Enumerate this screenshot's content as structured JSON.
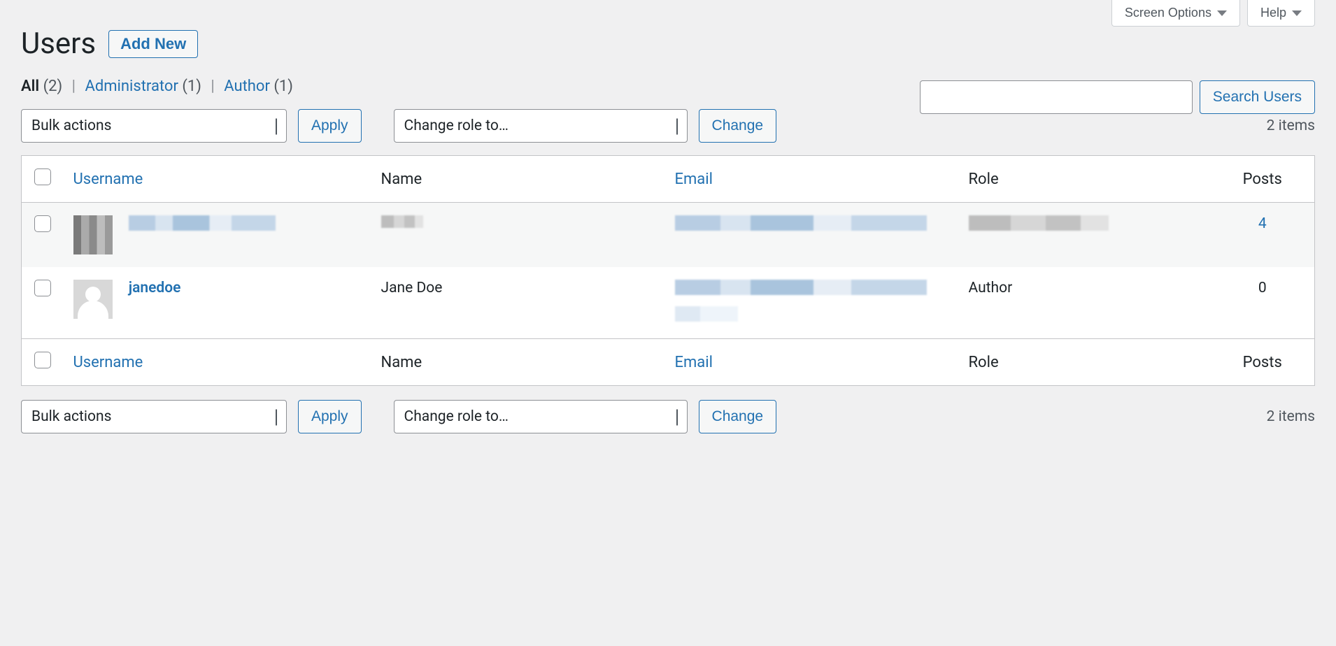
{
  "topButtons": {
    "screenOptions": "Screen Options",
    "help": "Help"
  },
  "header": {
    "title": "Users",
    "addNew": "Add New"
  },
  "filters": {
    "all_label": "All",
    "all_count": "(2)",
    "administrator_label": "Administrator",
    "administrator_count": "(1)",
    "author_label": "Author",
    "author_count": "(1)"
  },
  "search": {
    "button": "Search Users"
  },
  "bulk": {
    "bulkActions": "Bulk actions",
    "apply": "Apply",
    "changeRole": "Change role to…",
    "change": "Change"
  },
  "itemsCount": "2 items",
  "columns": {
    "username": "Username",
    "name": "Name",
    "email": "Email",
    "role": "Role",
    "posts": "Posts"
  },
  "rows": [
    {
      "username_redacted": true,
      "name_redacted": true,
      "email_redacted": true,
      "role_redacted": true,
      "posts": "4"
    },
    {
      "username": "janedoe",
      "name": "Jane Doe",
      "email_redacted": true,
      "role": "Author",
      "posts": "0"
    }
  ]
}
